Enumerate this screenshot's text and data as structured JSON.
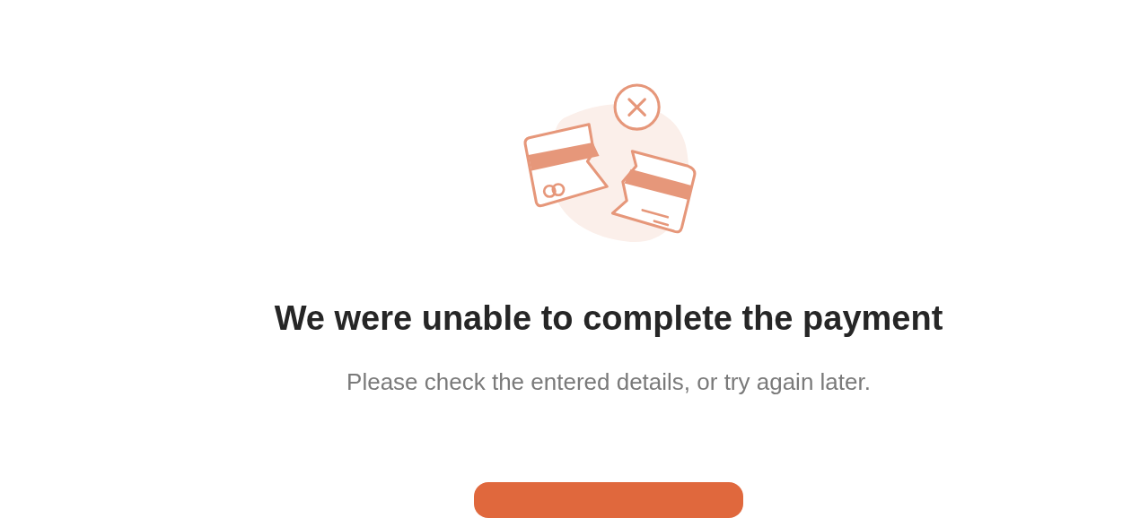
{
  "message": {
    "title": "We were unable to complete the payment",
    "subtitle": "Please check the entered details, or try again later."
  }
}
